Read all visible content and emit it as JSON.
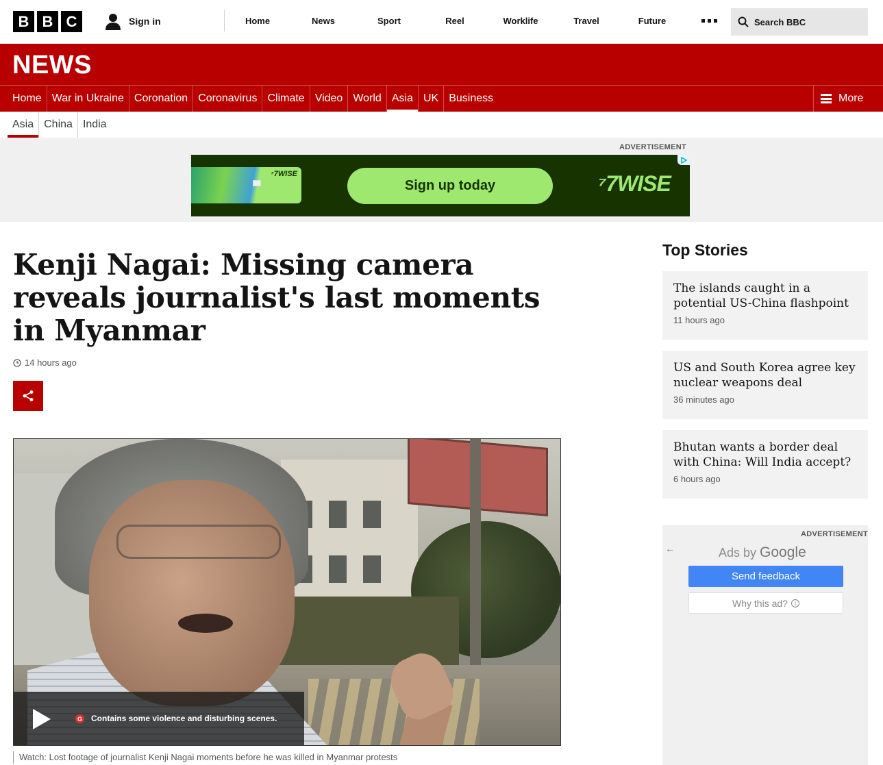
{
  "masthead": {
    "logo_letters": [
      "B",
      "B",
      "C"
    ],
    "signin_label": "Sign in",
    "nav": [
      "Home",
      "News",
      "Sport",
      "Reel",
      "Worklife",
      "Travel",
      "Future"
    ],
    "search_placeholder": "Search BBC"
  },
  "news_banner": {
    "title": "NEWS"
  },
  "news_nav": {
    "items": [
      "Home",
      "War in Ukraine",
      "Coronation",
      "Coronavirus",
      "Climate",
      "Video",
      "World",
      "Asia",
      "UK",
      "Business"
    ],
    "active": "Asia",
    "more_label": "More"
  },
  "sub_nav": {
    "items": [
      "Asia",
      "China",
      "India"
    ],
    "active": "Asia"
  },
  "top_ad": {
    "label": "ADVERTISEMENT",
    "card_brand": "⁷7WISE",
    "cta": "Sign up today",
    "brand": "⁷7WISE",
    "colors": {
      "bg": "#163300",
      "accent": "#9fe870"
    }
  },
  "article": {
    "headline": "Kenji Nagai: Missing camera reveals journalist's last moments in Myanmar",
    "timestamp": "14 hours ago",
    "video_warning": "Contains some violence and disturbing scenes.",
    "guidance_badge": "G",
    "caption": "Watch: Lost footage of journalist Kenji Nagai moments before he was killed in Myanmar protests"
  },
  "top_stories": {
    "title": "Top Stories",
    "items": [
      {
        "title": "The islands caught in a potential US-China flashpoint",
        "time": "11 hours ago"
      },
      {
        "title": "US and South Korea agree key nuclear weapons deal",
        "time": "36 minutes ago"
      },
      {
        "title": "Bhutan wants a border deal with China: Will India accept?",
        "time": "6 hours ago"
      }
    ]
  },
  "side_ad": {
    "label": "ADVERTISEMENT",
    "ads_by": "Ads by",
    "google": "Google",
    "feedback": "Send feedback",
    "why": "Why this ad?"
  },
  "colors": {
    "brand_red": "#b80000",
    "share_red": "#e00"
  }
}
